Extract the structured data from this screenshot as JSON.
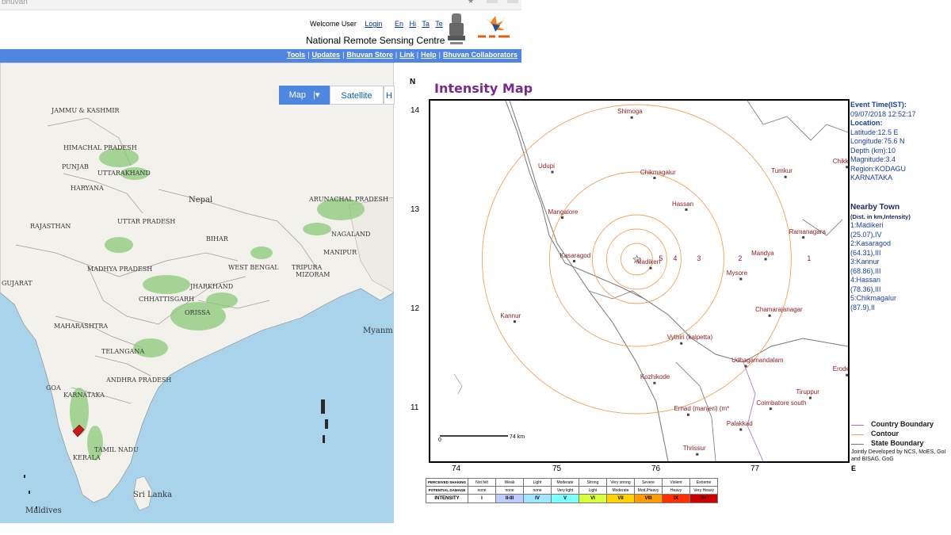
{
  "browser": {
    "url_fragment": "bhuvan"
  },
  "header": {
    "welcome": "Welcome User",
    "login": "Login",
    "languages": [
      "En",
      "Hi",
      "Ta",
      "Te"
    ],
    "org": "National Remote Sensing Centre"
  },
  "nav": {
    "links": [
      "Tools",
      "Updates",
      "Bhuvan Store",
      "Link",
      "Help",
      "Bhuvan Collaborators"
    ]
  },
  "map_tabs": {
    "map": "Map",
    "satellite": "Satellite",
    "hybrid": "H"
  },
  "map_places": {
    "j_and_k": "JAMMU & KASHMIR",
    "himachal": "HIMACHAL PRADESH",
    "punjab": "PUNJAB",
    "uttarakhand": "UTTARAKHAND",
    "haryana": "HARYANA",
    "nepal": "Nepal",
    "arunachal": "ARUNACHAL PRADESH",
    "rajasthan": "RAJASTHAN",
    "up": "UTTAR PRADESH",
    "bihar": "BIHAR",
    "nagaland": "NAGALAND",
    "manipur": "MANIPUR",
    "mp": "MADHYA PRADESH",
    "west_bengal": "WEST BENGAL",
    "tripura": "TRIPURA",
    "mizoram": "MIZORAM",
    "gujarat": "GUJARAT",
    "jharkhand": "JHARKHAND",
    "chhattisgarh": "CHHATTISGARH",
    "orissa": "ORISSA",
    "maharashtra": "MAHARASHTRA",
    "myanmar": "Myanm",
    "telangana": "TELANGANA",
    "andhra": "ANDHRA PRADESH",
    "goa": "GOA",
    "karnataka": "KARNATAKA",
    "tamil_nadu": "TAMIL NADU",
    "kerala": "KERALA",
    "sri_lanka": "Sri Lanka",
    "maldives": "Maldives"
  },
  "intensity_map": {
    "title": "Intensity Map",
    "y_axis_label": "N",
    "x_axis_label": "E",
    "y_ticks": [
      "14",
      "13",
      "12",
      "11"
    ],
    "x_ticks": [
      "74",
      "75",
      "76",
      "77"
    ],
    "epicenter": {
      "lon": 75.6,
      "lat": 12.5
    },
    "ring_labels": [
      "5",
      "4",
      "3",
      "2",
      "1"
    ],
    "towns": [
      {
        "name": "Shimoga",
        "lon": 75.55,
        "lat": 13.93
      },
      {
        "name": "Udupi",
        "lon": 74.75,
        "lat": 13.38
      },
      {
        "name": "Chikkaballapur",
        "lon": 77.72,
        "lat": 13.43
      },
      {
        "name": "Chikmagalur",
        "lon": 75.78,
        "lat": 13.32
      },
      {
        "name": "Tumkur",
        "lon": 77.1,
        "lat": 13.33
      },
      {
        "name": "Hassan",
        "lon": 76.1,
        "lat": 13.0
      },
      {
        "name": "Mangalore",
        "lon": 74.85,
        "lat": 12.92
      },
      {
        "name": "Ramanagara",
        "lon": 77.28,
        "lat": 12.72
      },
      {
        "name": "Kasaragod",
        "lon": 74.97,
        "lat": 12.48
      },
      {
        "name": "Mandya",
        "lon": 76.9,
        "lat": 12.5
      },
      {
        "name": "Madikeri",
        "lon": 75.74,
        "lat": 12.41
      },
      {
        "name": "Mysore",
        "lon": 76.65,
        "lat": 12.3
      },
      {
        "name": "Chamarajanagar",
        "lon": 76.94,
        "lat": 11.93
      },
      {
        "name": "Kannur",
        "lon": 74.37,
        "lat": 11.87
      },
      {
        "name": "Vythiri (kalpetta)",
        "lon": 76.05,
        "lat": 11.65
      },
      {
        "name": "Udhagamandalam",
        "lon": 76.7,
        "lat": 11.42
      },
      {
        "name": "Erode",
        "lon": 77.72,
        "lat": 11.33
      },
      {
        "name": "Kozhikode",
        "lon": 75.78,
        "lat": 11.25
      },
      {
        "name": "Tiruppur",
        "lon": 77.35,
        "lat": 11.1
      },
      {
        "name": "Ernad (manjeri) (m*",
        "lon": 76.12,
        "lat": 10.93
      },
      {
        "name": "Coimbatore south",
        "lon": 76.95,
        "lat": 10.99
      },
      {
        "name": "Palakkad",
        "lon": 76.65,
        "lat": 10.78
      },
      {
        "name": "Thrissur",
        "lon": 76.21,
        "lat": 10.53
      }
    ],
    "scale_label": "74 km",
    "scale_zero": "0"
  },
  "event_info": {
    "event_time_label": "Event Time(IST):",
    "event_time": "09/07/2018 12:52:17",
    "location_label": "Location:",
    "latitude": "Latitude:12.5 E",
    "longitude": "Longitude:75.6 N",
    "depth": "Depth (km):10",
    "magnitude": "Magnitude:3.4",
    "region": "Region:KODAGU",
    "state": "KARNATAKA"
  },
  "nearby": {
    "title": "Nearby Town",
    "subtitle": "(Dist. in km,Intensity)",
    "items": [
      {
        "line1": "1:Madikeri",
        "line2": "(25.07),IV"
      },
      {
        "line1": "2:Kasaragod",
        "line2": "(64.31),III"
      },
      {
        "line1": "3:Kannur",
        "line2": "(68.86),III"
      },
      {
        "line1": "4:Hassan",
        "line2": "(78.36),III"
      },
      {
        "line1": "5:Chikmagalur",
        "line2": "(87.9),II"
      }
    ]
  },
  "legend": {
    "country": "Country Boundary",
    "contour": "Contour",
    "state": "State Boundary",
    "credits": "Jointly Developed by NCS, MoES, GoI and BISAG, GoG",
    "colors": {
      "country": "#b266c8",
      "contour": "#f0a060",
      "state": "#777777"
    }
  },
  "scale_table": {
    "rows": {
      "shaking": "PERCEIVED SHAKING",
      "damage": "POTENTIAL DAMAGE",
      "intensity": "INTENSITY"
    },
    "shaking": [
      "Not felt",
      "Weak",
      "Light",
      "Moderate",
      "Strong",
      "Very strong",
      "Severe",
      "Violent",
      "Extreme"
    ],
    "damage": [
      "none",
      "none",
      "none",
      "Very light",
      "Light",
      "Moderate",
      "Mod./Heavy",
      "Heavy",
      "Very Heavy"
    ],
    "intensity": [
      "I",
      "II-III",
      "IV",
      "V",
      "VI",
      "VII",
      "VIII",
      "IX",
      "X+"
    ],
    "colors": [
      "#ffffff",
      "#bfccff",
      "#a0e6ff",
      "#80ffff",
      "#d8ff3c",
      "#ffd200",
      "#ff9a00",
      "#ff3000",
      "#c80000"
    ]
  }
}
